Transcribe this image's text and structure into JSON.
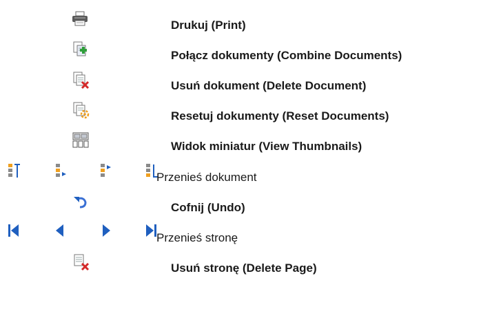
{
  "items": [
    {
      "icon": "printer-icon",
      "label": "Drukuj (Print)"
    },
    {
      "icon": "combine-documents-icon",
      "label": "Połącz dokumenty (Combine Documents)"
    },
    {
      "icon": "delete-document-icon",
      "label": "Usuń dokument (Delete Document)"
    },
    {
      "icon": "reset-documents-icon",
      "label": "Resetuj dokumenty (Reset Documents)"
    },
    {
      "icon": "view-thumbnails-icon",
      "label": "Widok miniatur (View Thumbnails)"
    }
  ],
  "move_document": {
    "icons": [
      "move-to-top-icon",
      "move-up-icon",
      "move-down-icon",
      "move-to-bottom-icon"
    ],
    "label": "Przenieś dokument"
  },
  "undo": {
    "icon": "undo-icon",
    "label": "Cofnij (Undo)"
  },
  "move_page": {
    "icons": [
      "first-page-icon",
      "previous-page-icon",
      "next-page-icon",
      "last-page-icon"
    ],
    "label": "Przenieś stronę"
  },
  "delete_page": {
    "icon": "delete-page-icon",
    "label": "Usuń stronę (Delete Page)"
  },
  "colors": {
    "icon_blue": "#1f5fbf",
    "icon_gray": "#8a8a8a",
    "accent_orange": "#f0a020",
    "delete_red": "#d42a2a",
    "add_green": "#2f9e3a"
  }
}
